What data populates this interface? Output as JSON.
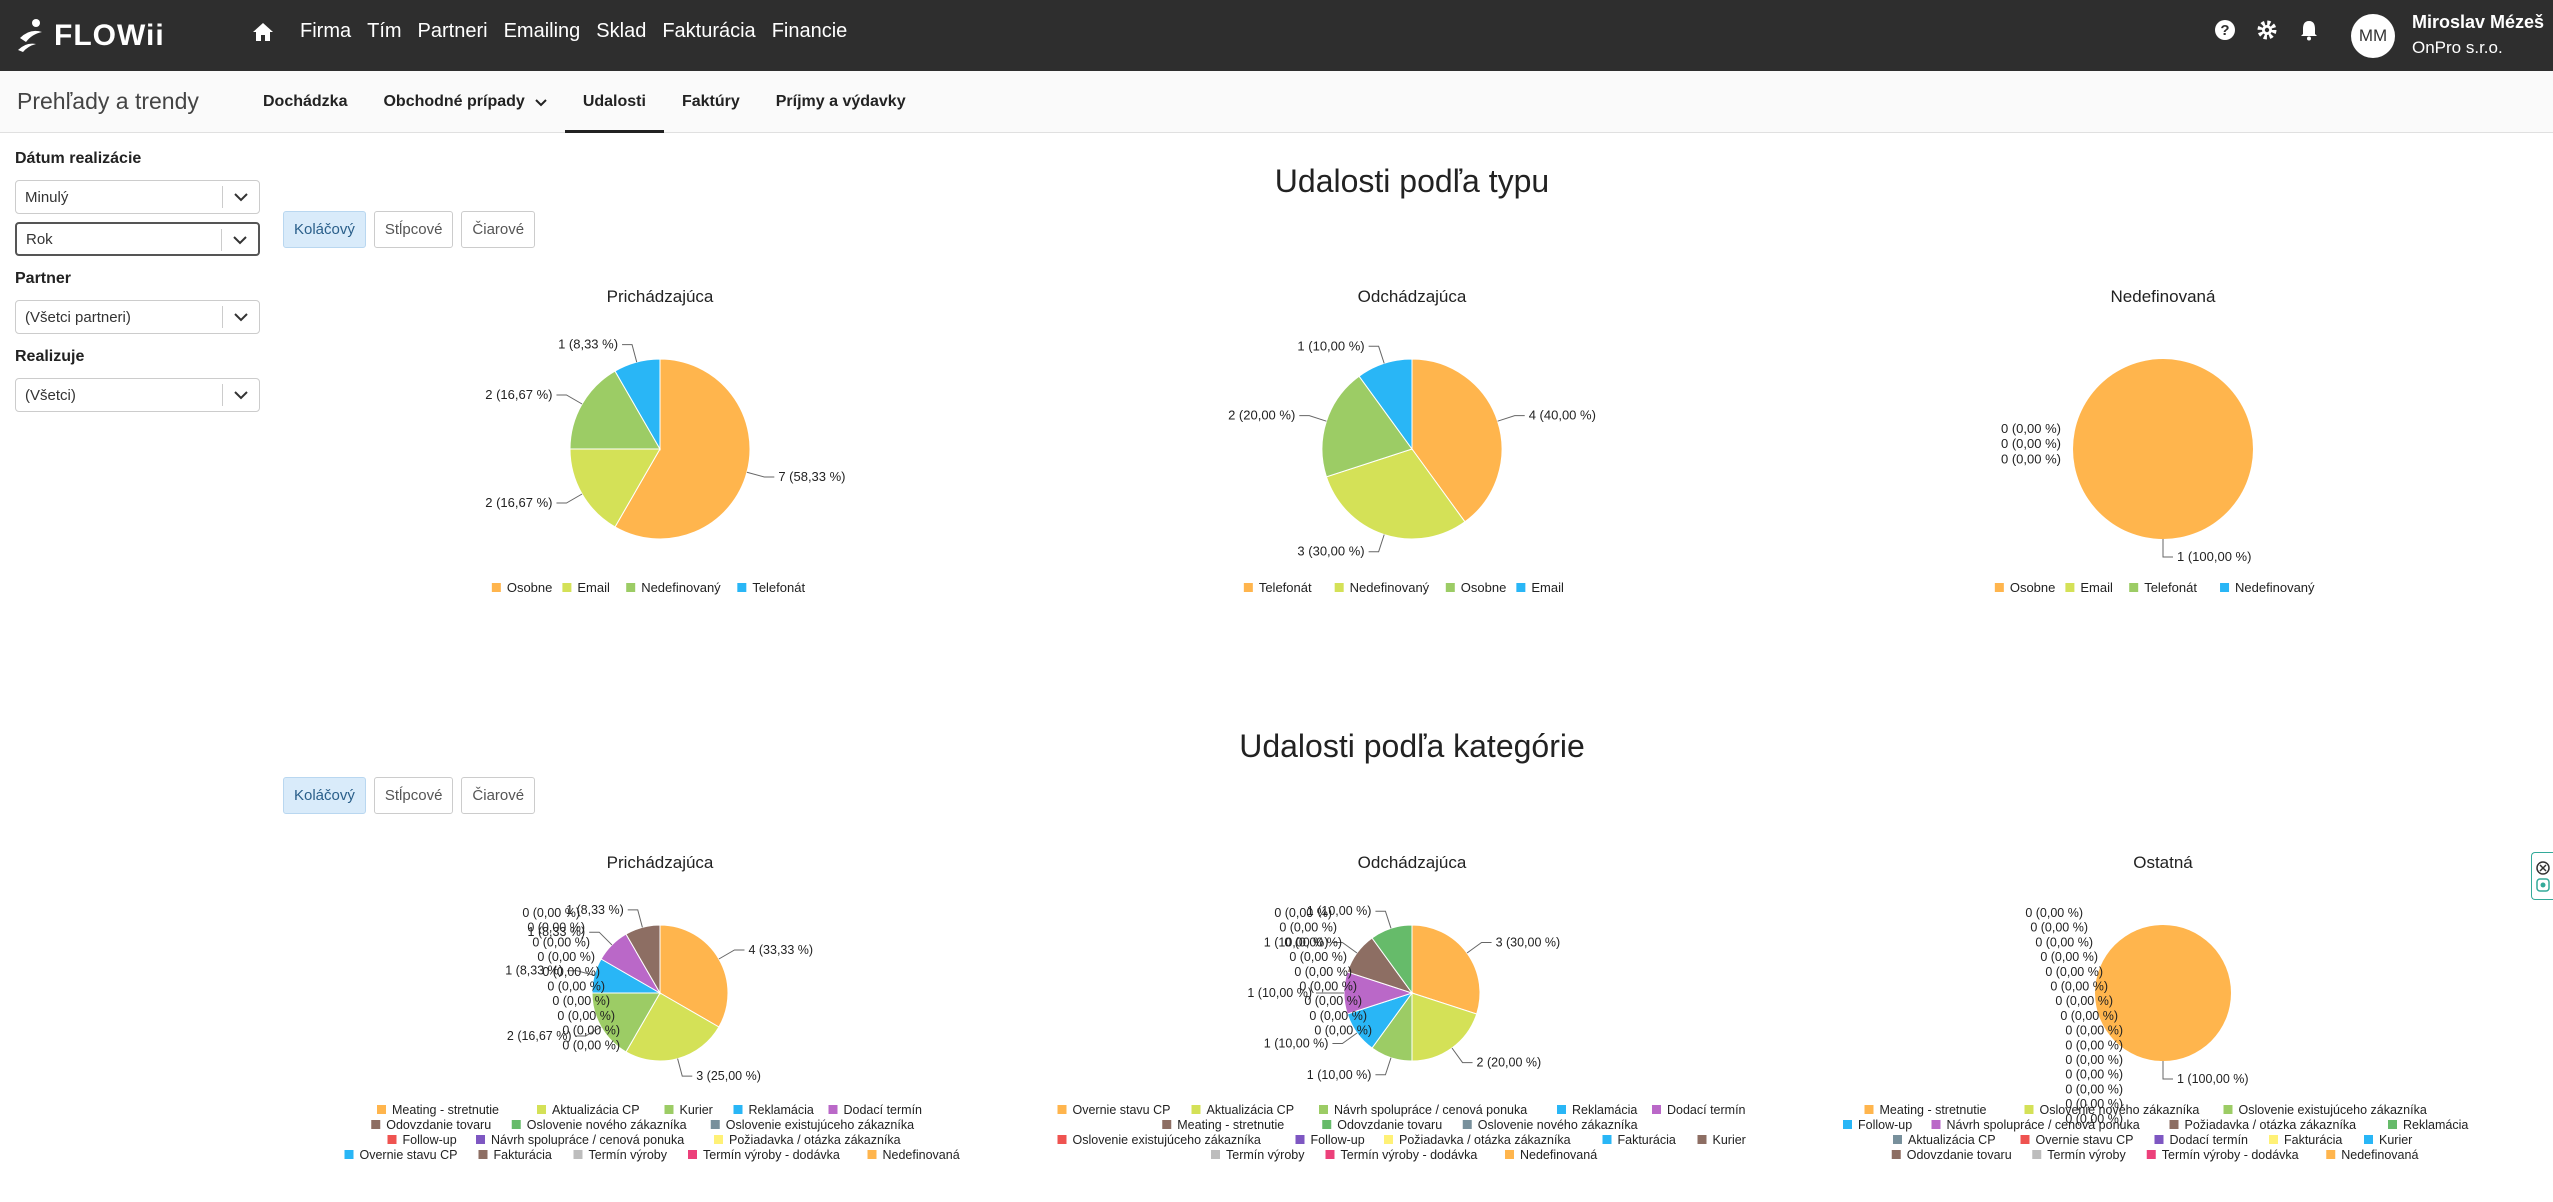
{
  "app": {
    "logo_text": "FLOWii"
  },
  "nav": {
    "items": [
      "Firma",
      "Tím",
      "Partneri",
      "Emailing",
      "Sklad",
      "Fakturácia",
      "Financie"
    ]
  },
  "user": {
    "initials": "MM",
    "name": "Miroslav Mézeš",
    "company": "OnPro s.r.o."
  },
  "header": {
    "title": "Prehľady a trendy",
    "tabs": [
      {
        "label": "Dochádzka",
        "active": false
      },
      {
        "label": "Obchodné prípady",
        "active": false,
        "dropdown": true
      },
      {
        "label": "Udalosti",
        "active": true
      },
      {
        "label": "Faktúry",
        "active": false
      },
      {
        "label": "Príjmy a výdavky",
        "active": false
      }
    ]
  },
  "filters": {
    "date_label": "Dátum realizácie",
    "date_value1": "Minulý",
    "date_value2": "Rok",
    "partner_label": "Partner",
    "partner_value": "(Všetci partneri)",
    "realization_label": "Realizuje",
    "realization_value": "(Všetci)"
  },
  "chart_buttons": [
    "Koláčový",
    "Stĺpcové",
    "Čiarové"
  ],
  "colors": {
    "orange": "#FFB54D",
    "yellowgreen": "#D4E157",
    "green": "#9CCC65",
    "blue": "#29B6F6",
    "purple": "#BA68C8",
    "brown": "#8D6E63",
    "red": "#EF5350",
    "grayblue": "#78909C",
    "lightyellow": "#FFF176",
    "violet": "#7E57C2",
    "pink": "#EC407A",
    "silver": "#BDBDBD",
    "teal": "#26A69A",
    "darkgreen": "#66BB6A",
    "lime": "#C0CA33"
  },
  "sections": [
    {
      "title": "Udalosti podľa typu"
    },
    {
      "title": "Udalosti podľa kategórie"
    }
  ],
  "chart_data": [
    {
      "type": "pie",
      "title": "Prichádzajúca",
      "slices": [
        {
          "name": "Osobne",
          "value": 7,
          "label": "7 (58,33 %)",
          "color": "#FFB54D"
        },
        {
          "name": "Email",
          "value": 2,
          "label": "2 (16,67 %)",
          "color": "#D4E157"
        },
        {
          "name": "Nedefinovaný",
          "value": 2,
          "label": "2 (16,67 %)",
          "color": "#9CCC65"
        },
        {
          "name": "Telefonát",
          "value": 1,
          "label": "1 (8,33 %)",
          "color": "#29B6F6"
        }
      ],
      "legend": [
        "Osobne",
        "Email",
        "Nedefinovaný",
        "Telefonát"
      ]
    },
    {
      "type": "pie",
      "title": "Odchádzajúca",
      "slices": [
        {
          "name": "Telefonát",
          "value": 4,
          "label": "4 (40,00 %)",
          "color": "#FFB54D"
        },
        {
          "name": "Nedefinovaný",
          "value": 3,
          "label": "3 (30,00 %)",
          "color": "#D4E157"
        },
        {
          "name": "Osobne",
          "value": 2,
          "label": "2 (20,00 %)",
          "color": "#9CCC65"
        },
        {
          "name": "Email",
          "value": 1,
          "label": "1 (10,00 %)",
          "color": "#29B6F6"
        }
      ],
      "legend": [
        "Telefonát",
        "Nedefinovaný",
        "Osobne",
        "Email"
      ]
    },
    {
      "type": "pie",
      "title": "Nedefinovaná",
      "slices": [
        {
          "name": "Osobne",
          "value": 1,
          "label": "1 (100,00 %)",
          "color": "#FFB54D"
        },
        {
          "name": "Email",
          "value": 0,
          "label": "0 (0,00 %)",
          "color": "#D4E157"
        },
        {
          "name": "Telefonát",
          "value": 0,
          "label": "0 (0,00 %)",
          "color": "#9CCC65"
        },
        {
          "name": "Nedefinovaný",
          "value": 0,
          "label": "0 (0,00 %)",
          "color": "#29B6F6"
        }
      ],
      "legend": [
        "Osobne",
        "Email",
        "Telefonát",
        "Nedefinovaný"
      ]
    },
    {
      "type": "pie",
      "title": "Prichádzajúca",
      "slices": [
        {
          "name": "Meating - stretnutie",
          "value": 4,
          "label": "4 (33,33 %)",
          "color": "#FFB54D"
        },
        {
          "name": "Aktualizácia CP",
          "value": 3,
          "label": "3 (25,00 %)",
          "color": "#D4E157"
        },
        {
          "name": "Kurier",
          "value": 2,
          "label": "2 (16,67 %)",
          "color": "#9CCC65"
        },
        {
          "name": "Reklamácia",
          "value": 1,
          "label": "1 (8,33 %)",
          "color": "#29B6F6"
        },
        {
          "name": "Dodací termín",
          "value": 1,
          "label": "1 (8,33 %)",
          "color": "#BA68C8"
        },
        {
          "name": "Odovzdanie tovaru",
          "value": 1,
          "label": "1 (8,33 %)",
          "color": "#8D6E63"
        },
        {
          "name": "Oslovenie nového zákazníka",
          "value": 0,
          "label": "0 (0,00 %)",
          "color": "#66BB6A"
        },
        {
          "name": "Oslovenie existujúceho zákazníka",
          "value": 0,
          "label": "0 (0,00 %)",
          "color": "#78909C"
        },
        {
          "name": "Follow-up",
          "value": 0,
          "label": "0 (0,00 %)",
          "color": "#EF5350"
        },
        {
          "name": "Návrh spolupráce / cenová ponuka",
          "value": 0,
          "label": "0 (0,00 %)",
          "color": "#7E57C2"
        },
        {
          "name": "Požiadavka / otázka zákazníka",
          "value": 0,
          "label": "0 (0,00 %)",
          "color": "#FFF176"
        },
        {
          "name": "Overnie stavu CP",
          "value": 0,
          "label": "0 (0,00 %)",
          "color": "#29B6F6"
        },
        {
          "name": "Fakturácia",
          "value": 0,
          "label": "0 (0,00 %)",
          "color": "#8D6E63"
        },
        {
          "name": "Termín výroby",
          "value": 0,
          "label": "0 (0,00 %)",
          "color": "#BDBDBD"
        },
        {
          "name": "Termín výroby - dodávka",
          "value": 0,
          "label": "0 (0,00 %)",
          "color": "#EC407A"
        },
        {
          "name": "Nedefinovaná",
          "value": 0,
          "label": "0 (0,00 %)",
          "color": "#FFB54D"
        }
      ],
      "legend": [
        "Meating - stretnutie",
        "Aktualizácia CP",
        "Kurier",
        "Reklamácia",
        "Dodací termín",
        "Odovzdanie tovaru",
        "Oslovenie nového zákazníka",
        "Oslovenie existujúceho zákazníka",
        "Follow-up",
        "Návrh spolupráce / cenová ponuka",
        "Požiadavka / otázka zákazníka",
        "Overnie stavu CP",
        "Fakturácia",
        "Termín výroby",
        "Termín výroby - dodávka",
        "Nedefinovaná"
      ]
    },
    {
      "type": "pie",
      "title": "Odchádzajúca",
      "slices": [
        {
          "name": "Overnie stavu CP",
          "value": 3,
          "label": "3 (30,00 %)",
          "color": "#FFB54D"
        },
        {
          "name": "Aktualizácia CP",
          "value": 2,
          "label": "2 (20,00 %)",
          "color": "#D4E157"
        },
        {
          "name": "Návrh spolupráce / cenová ponuka",
          "value": 1,
          "label": "1 (10,00 %)",
          "color": "#9CCC65"
        },
        {
          "name": "Reklamácia",
          "value": 1,
          "label": "1 (10,00 %)",
          "color": "#29B6F6"
        },
        {
          "name": "Dodací termín",
          "value": 1,
          "label": "1 (10,00 %)",
          "color": "#BA68C8"
        },
        {
          "name": "Meating - stretnutie",
          "value": 1,
          "label": "1 (10,00 %)",
          "color": "#8D6E63"
        },
        {
          "name": "Odovzdanie tovaru",
          "value": 1,
          "label": "1 (10,00 %)",
          "color": "#66BB6A"
        },
        {
          "name": "Oslovenie nového zákazníka",
          "value": 0,
          "label": "0 (0,00 %)",
          "color": "#78909C"
        },
        {
          "name": "Oslovenie existujúceho zákazníka",
          "value": 0,
          "label": "0 (0,00 %)",
          "color": "#EF5350"
        },
        {
          "name": "Follow-up",
          "value": 0,
          "label": "0 (0,00 %)",
          "color": "#7E57C2"
        },
        {
          "name": "Požiadavka / otázka zákazníka",
          "value": 0,
          "label": "0 (0,00 %)",
          "color": "#FFF176"
        },
        {
          "name": "Fakturácia",
          "value": 0,
          "label": "0 (0,00 %)",
          "color": "#29B6F6"
        },
        {
          "name": "Kurier",
          "value": 0,
          "label": "0 (0,00 %)",
          "color": "#8D6E63"
        },
        {
          "name": "Termín výroby",
          "value": 0,
          "label": "0 (0,00 %)",
          "color": "#BDBDBD"
        },
        {
          "name": "Termín výroby - dodávka",
          "value": 0,
          "label": "0 (0,00 %)",
          "color": "#EC407A"
        },
        {
          "name": "Nedefinovaná",
          "value": 0,
          "label": "0 (0,00 %)",
          "color": "#FFB54D"
        }
      ],
      "legend": [
        "Overnie stavu CP",
        "Aktualizácia CP",
        "Návrh spolupráce / cenová ponuka",
        "Reklamácia",
        "Dodací termín",
        "Meating - stretnutie",
        "Odovzdanie tovaru",
        "Oslovenie nového zákazníka",
        "Oslovenie existujúceho zákazníka",
        "Follow-up",
        "Požiadavka / otázka zákazníka",
        "Fakturácia",
        "Kurier",
        "Termín výroby",
        "Termín výroby - dodávka",
        "Nedefinovaná"
      ]
    },
    {
      "type": "pie",
      "title": "Ostatná",
      "slices": [
        {
          "name": "Meating - stretnutie",
          "value": 1,
          "label": "1 (100,00 %)",
          "color": "#FFB54D"
        },
        {
          "name": "Oslovenie nového zákazníka",
          "value": 0,
          "label": "0 (0,00 %)",
          "color": "#D4E157"
        },
        {
          "name": "Oslovenie existujúceho zákazníka",
          "value": 0,
          "label": "0 (0,00 %)",
          "color": "#9CCC65"
        },
        {
          "name": "Follow-up",
          "value": 0,
          "label": "0 (0,00 %)",
          "color": "#29B6F6"
        },
        {
          "name": "Návrh spolupráce / cenová ponuka",
          "value": 0,
          "label": "0 (0,00 %)",
          "color": "#BA68C8"
        },
        {
          "name": "Požiadavka / otázka zákazníka",
          "value": 0,
          "label": "0 (0,00 %)",
          "color": "#8D6E63"
        },
        {
          "name": "Reklamácia",
          "value": 0,
          "label": "0 (0,00 %)",
          "color": "#66BB6A"
        },
        {
          "name": "Aktualizácia CP",
          "value": 0,
          "label": "0 (0,00 %)",
          "color": "#78909C"
        },
        {
          "name": "Overnie stavu CP",
          "value": 0,
          "label": "0 (0,00 %)",
          "color": "#EF5350"
        },
        {
          "name": "Dodací termín",
          "value": 0,
          "label": "0 (0,00 %)",
          "color": "#7E57C2"
        },
        {
          "name": "Fakturácia",
          "value": 0,
          "label": "0 (0,00 %)",
          "color": "#FFF176"
        },
        {
          "name": "Kurier",
          "value": 0,
          "label": "0 (0,00 %)",
          "color": "#29B6F6"
        },
        {
          "name": "Odovzdanie tovaru",
          "value": 0,
          "label": "0 (0,00 %)",
          "color": "#8D6E63"
        },
        {
          "name": "Termín výroby",
          "value": 0,
          "label": "0 (0,00 %)",
          "color": "#BDBDBD"
        },
        {
          "name": "Termín výroby - dodávka",
          "value": 0,
          "label": "0 (0,00 %)",
          "color": "#EC407A"
        },
        {
          "name": "Nedefinovaná",
          "value": 0,
          "label": "0 (0,00 %)",
          "color": "#FFB54D"
        }
      ],
      "legend": [
        "Meating - stretnutie",
        "Oslovenie nového zákazníka",
        "Oslovenie existujúceho zákazníka",
        "Follow-up",
        "Návrh spolupráce / cenová ponuka",
        "Požiadavka / otázka zákazníka",
        "Reklamácia",
        "Aktualizácia CP",
        "Overnie stavu CP",
        "Dodací termín",
        "Fakturácia",
        "Kurier",
        "Odovzdanie tovaru",
        "Termín výroby",
        "Termín výroby - dodávka",
        "Nedefinovaná"
      ]
    }
  ]
}
